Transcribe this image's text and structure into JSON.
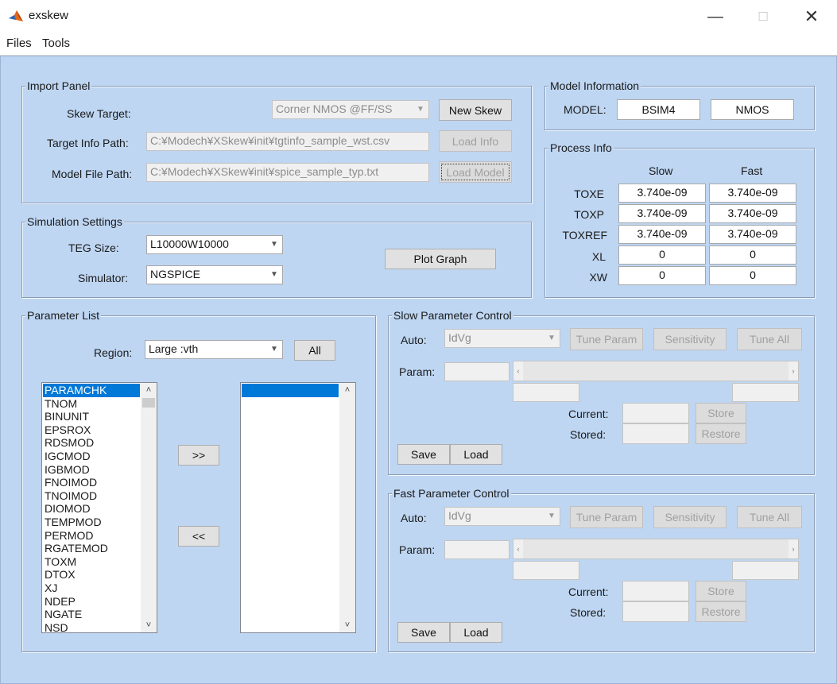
{
  "window": {
    "title": "exskew",
    "minimize_icon": "minimize-icon",
    "maximize_icon": "maximize-icon",
    "close_icon": "close-icon"
  },
  "menu": [
    "Files",
    "Tools"
  ],
  "import_panel": {
    "title": "Import Panel",
    "skew_target_label": "Skew Target:",
    "skew_target_value": "Corner NMOS @FF/SS",
    "new_skew_button": "New Skew",
    "target_info_label": "Target Info Path:",
    "target_info_path": "C:¥Modech¥XSkew¥init¥tgtinfo_sample_wst.csv",
    "load_info_button": "Load Info",
    "model_file_label": "Model File Path:",
    "model_file_path": "C:¥Modech¥XSkew¥init¥spice_sample_typ.txt",
    "load_model_button": "Load Model"
  },
  "model_info": {
    "title": "Model Information",
    "model_label": "MODEL:",
    "model_value": "BSIM4",
    "type_value": "NMOS"
  },
  "process_info": {
    "title": "Process Info",
    "col_slow": "Slow",
    "col_fast": "Fast",
    "rows": [
      {
        "name": "TOXE",
        "slow": "3.740e-09",
        "fast": "3.740e-09"
      },
      {
        "name": "TOXP",
        "slow": "3.740e-09",
        "fast": "3.740e-09"
      },
      {
        "name": "TOXREF",
        "slow": "3.740e-09",
        "fast": "3.740e-09"
      },
      {
        "name": "XL",
        "slow": "0",
        "fast": "0"
      },
      {
        "name": "XW",
        "slow": "0",
        "fast": "0"
      }
    ]
  },
  "simulation": {
    "title": "Simulation Settings",
    "teg_label": "TEG Size:",
    "teg_value": "L10000W10000",
    "simulator_label": "Simulator:",
    "simulator_value": "NGSPICE",
    "plot_button": "Plot Graph"
  },
  "parameter_list": {
    "title": "Parameter List",
    "region_label": "Region:",
    "region_value": "Large :vth",
    "all_button": "All",
    "add_button": ">>",
    "remove_button": "<<",
    "items": [
      "PARAMCHK",
      "TNOM",
      "BINUNIT",
      "EPSROX",
      "RDSMOD",
      "IGCMOD",
      "IGBMOD",
      "FNOIMOD",
      "TNOIMOD",
      "DIOMOD",
      "TEMPMOD",
      "PERMOD",
      "RGATEMOD",
      "TOXM",
      "DTOX",
      "XJ",
      "NDEP",
      "NGATE",
      "NSD"
    ],
    "selected_index": 0
  },
  "slow_control": {
    "title": "Slow Parameter Control",
    "auto_label": "Auto:",
    "auto_value": "IdVg",
    "tune_param": "Tune Param",
    "sensitivity": "Sensitivity",
    "tune_all": "Tune All",
    "param_label": "Param:",
    "current_label": "Current:",
    "stored_label": "Stored:",
    "store_button": "Store",
    "restore_button": "Restore",
    "save_button": "Save",
    "load_button": "Load"
  },
  "fast_control": {
    "title": "Fast Parameter Control",
    "auto_label": "Auto:",
    "auto_value": "IdVg",
    "tune_param": "Tune Param",
    "sensitivity": "Sensitivity",
    "tune_all": "Tune All",
    "param_label": "Param:",
    "current_label": "Current:",
    "stored_label": "Stored:",
    "store_button": "Store",
    "restore_button": "Restore",
    "save_button": "Save",
    "load_button": "Load"
  }
}
